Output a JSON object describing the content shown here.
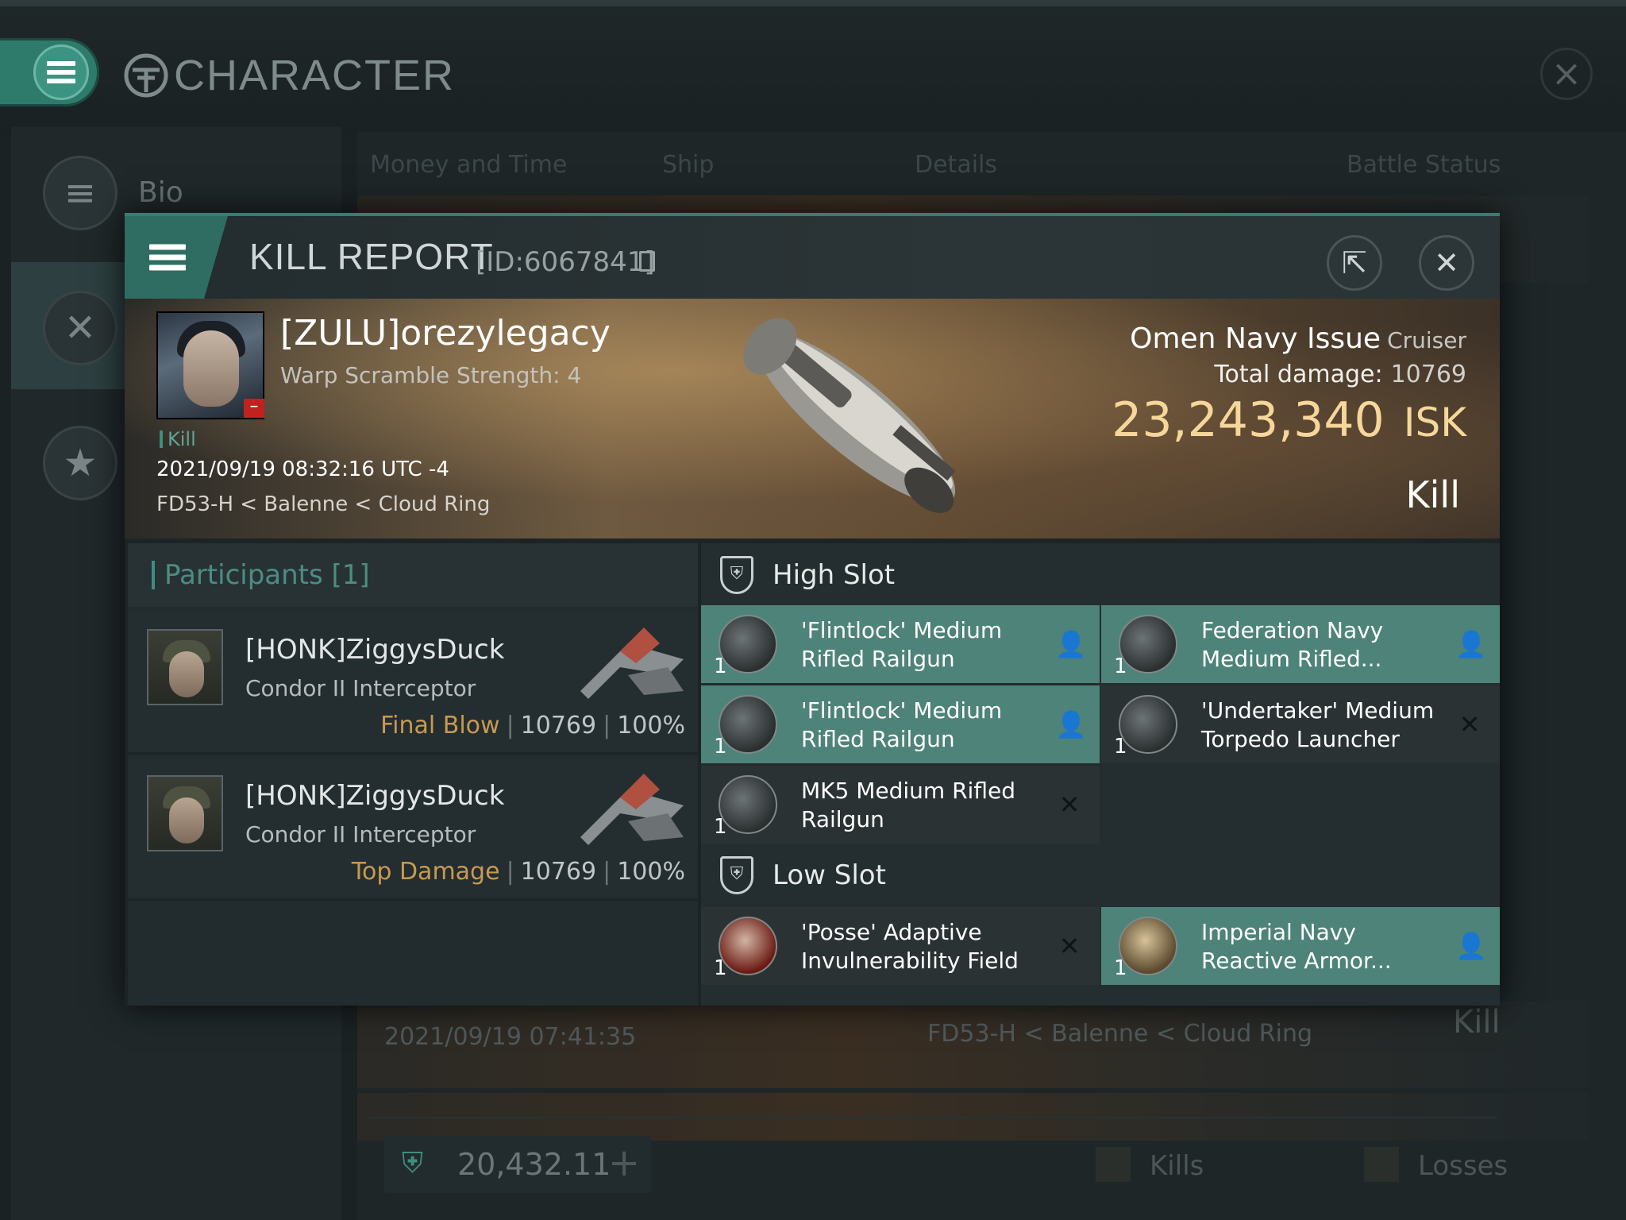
{
  "window": {
    "title": "CHARACTER",
    "sidebar": [
      {
        "label": "Bio",
        "icon": "menu-icon"
      },
      {
        "label": "",
        "icon": "crossed-swords-icon"
      },
      {
        "label": "",
        "icon": "star-icon"
      }
    ]
  },
  "background_table": {
    "columns": [
      "Money and Time",
      "Ship",
      "Details",
      "Battle Status"
    ],
    "rows": [
      {
        "date": "2021/09/19  07:41:35",
        "location": "FD53-H < Balenne < Cloud Ring",
        "status": "Kill"
      }
    ],
    "wallet": "20,432.11",
    "legend": [
      "Kills",
      "Losses"
    ]
  },
  "kill_report": {
    "title": "KILL REPORT",
    "id": "[ID:6067841]",
    "victim": {
      "name": "[ZULU]orezylegacy",
      "warp_scramble": "Warp Scramble Strength: 4",
      "tag": "Kill",
      "datetime": "2021/09/19 08:32:16 UTC -4",
      "location": "FD53-H < Balenne < Cloud Ring"
    },
    "ship": {
      "name": "Omen Navy Issue",
      "class": "Cruiser",
      "total_damage_label": "Total damage:",
      "total_damage": "10769",
      "isk_value": "23,243,340",
      "isk_unit": "ISK",
      "status": "Kill"
    },
    "participants": {
      "title": "Participants [1]",
      "rows": [
        {
          "name": "[HONK]ZiggysDuck",
          "ship": "Condor II Interceptor",
          "label": "Final Blow",
          "damage": "10769",
          "percent": "100%"
        },
        {
          "name": "[HONK]ZiggysDuck",
          "ship": "Condor II Interceptor",
          "label": "Top Damage",
          "damage": "10769",
          "percent": "100%"
        }
      ]
    },
    "high_slot": {
      "title": "High Slot",
      "modules": [
        {
          "qty": "1",
          "name": "'Flintlock' Medium Rifled Railgun",
          "state": "dropped"
        },
        {
          "qty": "1",
          "name": "Federation Navy Medium Rifled...",
          "state": "dropped"
        },
        {
          "qty": "1",
          "name": "'Flintlock' Medium Rifled Railgun",
          "state": "dropped"
        },
        {
          "qty": "1",
          "name": "'Undertaker' Medium Torpedo Launcher",
          "state": "destroyed"
        },
        {
          "qty": "1",
          "name": "MK5 Medium Rifled Railgun",
          "state": "destroyed"
        }
      ]
    },
    "low_slot": {
      "title": "Low Slot",
      "modules": [
        {
          "qty": "1",
          "name": "'Posse' Adaptive Invulnerability Field",
          "state": "destroyed"
        },
        {
          "qty": "1",
          "name": "Imperial Navy Reactive Armor...",
          "state": "dropped"
        }
      ]
    }
  },
  "colors": {
    "accent": "#2f7b6b",
    "dropped_bg": "#4e8379",
    "isk": "#f6d79a",
    "label_gold": "#c79a52",
    "loss_badge": "#c0221f"
  }
}
